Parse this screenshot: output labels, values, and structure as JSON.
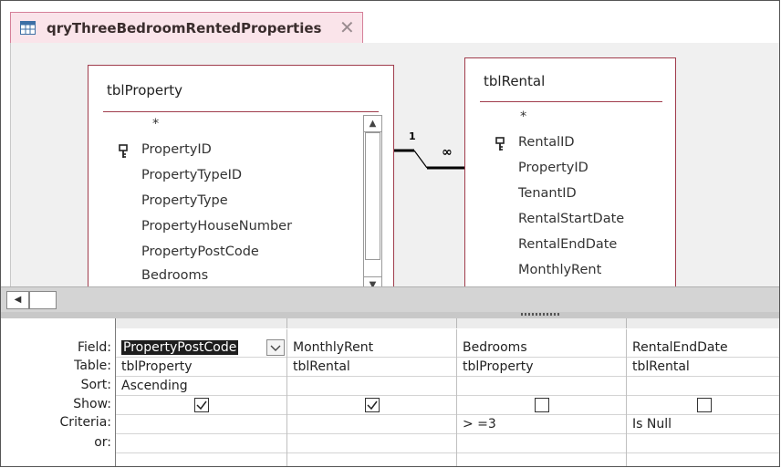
{
  "tab": {
    "title": "qryThreeBedroomRentedProperties",
    "close_glyph": "✕",
    "icon": "query-icon"
  },
  "tables": [
    {
      "name": "tblProperty",
      "fields": [
        {
          "label": "*",
          "key": false
        },
        {
          "label": "PropertyID",
          "key": true
        },
        {
          "label": "PropertyTypeID",
          "key": false
        },
        {
          "label": "PropertyType",
          "key": false
        },
        {
          "label": "PropertyHouseNumber",
          "key": false
        },
        {
          "label": "PropertyPostCode",
          "key": false
        },
        {
          "label": "Bedrooms",
          "key": false
        }
      ]
    },
    {
      "name": "tblRental",
      "fields": [
        {
          "label": "*",
          "key": false
        },
        {
          "label": "RentalID",
          "key": true
        },
        {
          "label": "PropertyID",
          "key": false
        },
        {
          "label": "TenantID",
          "key": false
        },
        {
          "label": "RentalStartDate",
          "key": false
        },
        {
          "label": "RentalEndDate",
          "key": false
        },
        {
          "label": "MonthlyRent",
          "key": false
        }
      ]
    }
  ],
  "relationship": {
    "one_label": "1",
    "many_label": "∞"
  },
  "grid": {
    "row_labels": [
      "Field:",
      "Table:",
      "Sort:",
      "Show:",
      "Criteria:",
      "or:"
    ],
    "columns": [
      {
        "field": "PropertyPostCode",
        "table": "tblProperty",
        "sort": "Ascending",
        "show": true,
        "criteria": "",
        "or": ""
      },
      {
        "field": "MonthlyRent",
        "table": "tblRental",
        "sort": "",
        "show": true,
        "criteria": "",
        "or": ""
      },
      {
        "field": "Bedrooms",
        "table": "tblProperty",
        "sort": "",
        "show": false,
        "criteria": "> =3",
        "or": ""
      },
      {
        "field": "RentalEndDate",
        "table": "tblRental",
        "sort": "",
        "show": false,
        "criteria": "Is Null",
        "or": ""
      }
    ]
  },
  "colors": {
    "tab_bg": "#fae4ea",
    "table_border": "#a03c4c",
    "design_bg": "#f0f0f0"
  }
}
